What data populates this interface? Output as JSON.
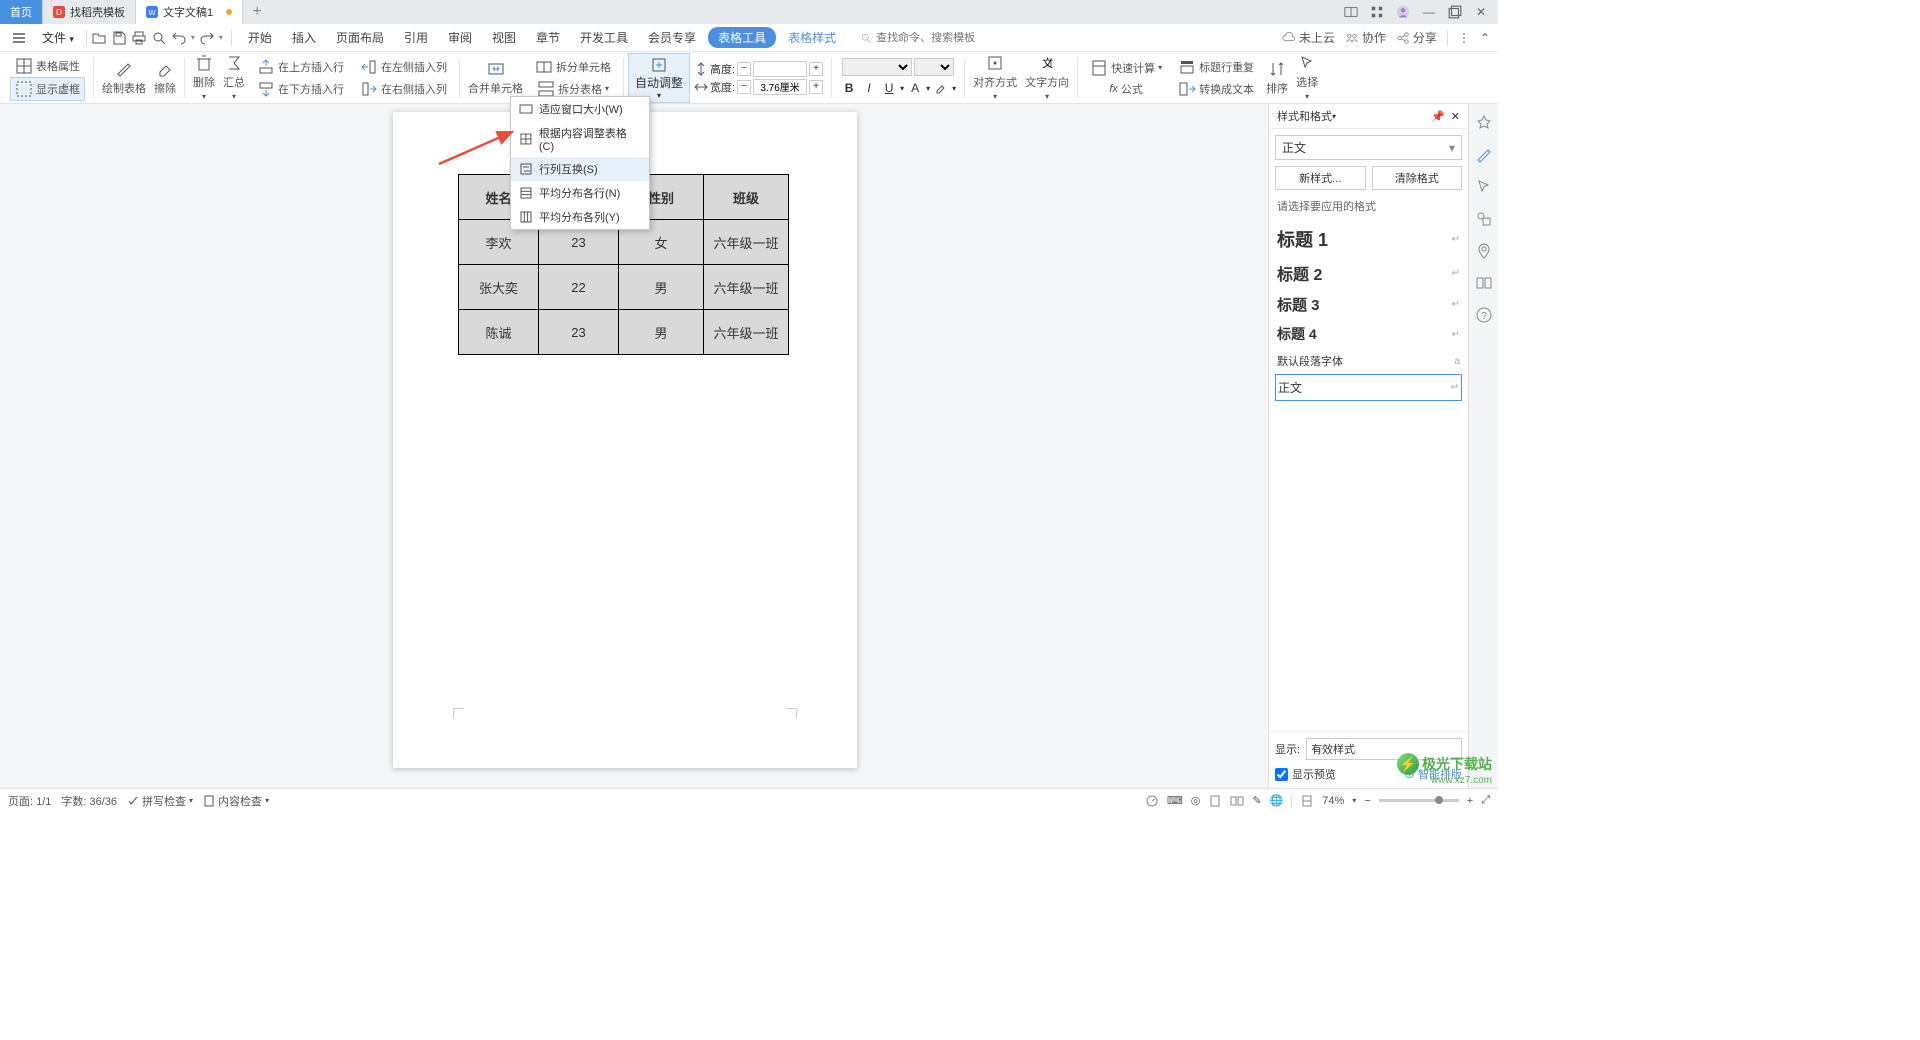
{
  "tabs": {
    "home": "首页",
    "template": "找稻壳模板",
    "doc": "文字文稿1",
    "modified": true
  },
  "quick": {
    "file": "文件"
  },
  "menu": {
    "items": [
      "开始",
      "插入",
      "页面布局",
      "引用",
      "审阅",
      "视图",
      "章节",
      "开发工具",
      "会员专享"
    ],
    "tableTools": "表格工具",
    "tableStyle": "表格样式",
    "searchPlaceholder": "查找命令、搜索模板"
  },
  "topright": {
    "cloud": "未上云",
    "collab": "协作",
    "share": "分享"
  },
  "ribbon": {
    "tableProps": "表格属性",
    "showGrid": "显示虚框",
    "drawTable": "绘制表格",
    "erase": "擦除",
    "delete": "删除",
    "summary": "汇总",
    "insAbove": "在上方插入行",
    "insBelow": "在下方插入行",
    "insLeft": "在左侧插入列",
    "insRight": "在右侧插入列",
    "mergeCells": "合并单元格",
    "splitCells": "拆分单元格",
    "splitTable": "拆分表格",
    "autoFit": "自动调整",
    "height": "高度:",
    "width": "宽度:",
    "widthValue": "3.76厘米",
    "align": "对齐方式",
    "textDir": "文字方向",
    "quickCalc": "快速计算",
    "headerRepeat": "标题行重复",
    "formula": "公式",
    "toText": "转换成文本",
    "sort": "排序",
    "select": "选择"
  },
  "dropdown": {
    "fitWindow": "适应窗口大小(W)",
    "fitContent": "根据内容调整表格(C)",
    "swapRC": "行列互换(S)",
    "distRows": "平均分布各行(N)",
    "distCols": "平均分布各列(Y)"
  },
  "table": {
    "headers": [
      "姓名",
      "",
      "性别",
      "班级"
    ],
    "rows": [
      [
        "李欢",
        "23",
        "女",
        "六年级一班"
      ],
      [
        "张大奕",
        "22",
        "男",
        "六年级一班"
      ],
      [
        "陈诚",
        "23",
        "男",
        "六年级一班"
      ]
    ]
  },
  "panel": {
    "title": "样式和格式",
    "current": "正文",
    "newStyle": "新样式...",
    "clearFmt": "清除格式",
    "hint": "请选择要应用的格式",
    "styles": {
      "h1": "标题 1",
      "h2": "标题 2",
      "h3": "标题 3",
      "h4": "标题 4",
      "parafont": "默认段落字体",
      "body": "正文"
    },
    "displayLabel": "显示:",
    "displayValue": "有效样式",
    "preview": "显示预览",
    "smart": "智能排版"
  },
  "status": {
    "page": "页面: 1/1",
    "words": "字数: 36/36",
    "spell": "拼写检查",
    "content": "内容检查",
    "zoom": "74%"
  },
  "watermark": {
    "brand": "极光下载站",
    "url": "www.xz7.com"
  }
}
